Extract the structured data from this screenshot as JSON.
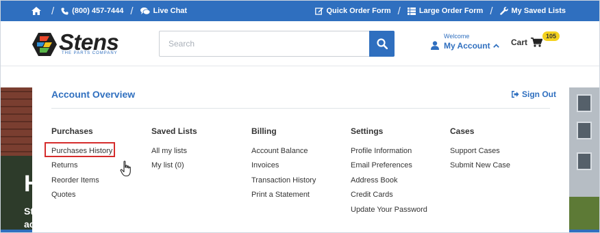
{
  "topbar": {
    "phone": "(800) 457-7444",
    "live_chat": "Live Chat",
    "quick_order": "Quick Order Form",
    "large_order": "Large Order Form",
    "saved_lists": "My Saved Lists",
    "color": "#2f6fbf"
  },
  "header": {
    "logo_text": "Stens",
    "logo_tagline": "THE PARTS COMPANY",
    "search_placeholder": "Search",
    "welcome": "Welcome",
    "account_label": "My Account",
    "cart_label": "Cart",
    "cart_count": "105"
  },
  "hero": {
    "heading_fragment": "H",
    "line1_fragment": "St",
    "line2_fragment": "ac"
  },
  "dropdown": {
    "title": "Account Overview",
    "sign_out": "Sign Out",
    "columns": [
      {
        "heading": "Purchases",
        "items": [
          "Purchases History",
          "Returns",
          "Reorder Items",
          "Quotes"
        ]
      },
      {
        "heading": "Saved Lists",
        "items": [
          "All my lists",
          "My list (0)"
        ]
      },
      {
        "heading": "Billing",
        "items": [
          "Account Balance",
          "Invoices",
          "Transaction History",
          "Print a Statement"
        ]
      },
      {
        "heading": "Settings",
        "items": [
          "Profile Information",
          "Email Preferences",
          "Address Book",
          "Credit Cards",
          "Update Your Password"
        ]
      },
      {
        "heading": "Cases",
        "items": [
          "Support Cases",
          "Submit New Case"
        ]
      }
    ],
    "highlighted_item": "Purchases History",
    "highlight_color": "#d52b2b"
  }
}
